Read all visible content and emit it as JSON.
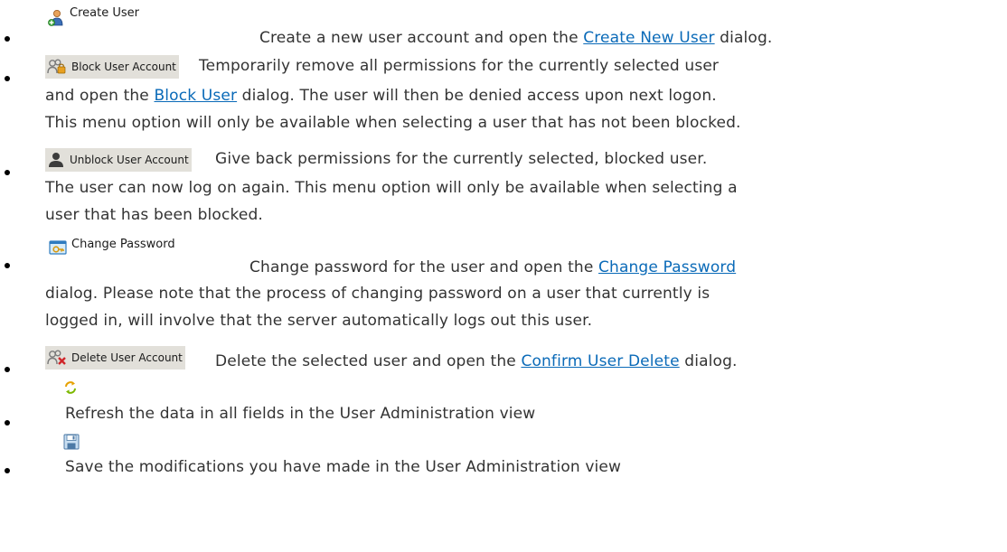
{
  "items": [
    {
      "button_label": "Create User",
      "icon": "create-user-icon",
      "segments": [
        {
          "t": "Create a new user account and open the "
        },
        {
          "link": "Create New User"
        },
        {
          "t": " dialog."
        }
      ]
    },
    {
      "button_label": "Block User Account",
      "icon": "block-user-icon",
      "line1": [
        {
          "t": "Temporarily remove all permissions for the currently selected user"
        }
      ],
      "line2": [
        {
          "t": "and open the "
        },
        {
          "link": "Block User"
        },
        {
          "t": " dialog. The user will then be denied access upon next logon."
        }
      ],
      "line3": "This menu option will only be available when selecting a user that has not been blocked."
    },
    {
      "button_label": "Unblock User Account",
      "icon": "unblock-user-icon",
      "line1": "Give back permissions for the currently selected, blocked user.",
      "line2": "The user can now log on again. This menu option will only be available when selecting a",
      "line3": "user that has been blocked."
    },
    {
      "button_label": "Change Password",
      "icon": "change-password-icon",
      "line1": [
        {
          "t": "Change password for the user and open the "
        },
        {
          "link": "Change Password"
        }
      ],
      "line2": "dialog. Please note that the process of changing password on a user that currently is",
      "line3": "logged in, will involve that the server automatically logs out this user."
    },
    {
      "button_label": "Delete User Account",
      "icon": "delete-user-icon",
      "segments": [
        {
          "t": "Delete the selected user and open the "
        },
        {
          "link": "Confirm User Delete"
        },
        {
          "t": " dialog."
        }
      ]
    },
    {
      "icon": "refresh-icon",
      "text": "Refresh the data in all fields in the User Administration view"
    },
    {
      "icon": "save-icon",
      "text": "Save the modifications you have made in the User Administration view"
    }
  ],
  "b": {
    "i0": {
      "label": "Create User",
      "t1": "Create a new user account and open the ",
      "link": "Create New User",
      "t2": " dialog."
    },
    "i1": {
      "label": "Block User Account",
      "l1": "Temporarily remove all permissions for the currently selected user",
      "l2a": "and open the ",
      "link": "Block User",
      "l2b": " dialog. The user will then be denied access upon next logon.",
      "l3": "This menu option will only be available when selecting a user that has not been blocked."
    },
    "i2": {
      "label": "Unblock User Account",
      "l1": "Give back permissions for the currently selected, blocked user.",
      "l2": "The user can now log on again. This menu option will only be available when selecting a",
      "l3": "user that has been blocked."
    },
    "i3": {
      "label": "Change Password",
      "l1a": "Change password for the user and open the ",
      "link": "Change Password",
      "l2": "dialog. Please note that the process of changing password on a user that currently is",
      "l3": "logged in, will involve that the server automatically logs out this user."
    },
    "i4": {
      "label": "Delete User Account",
      "t1": "Delete the selected user and open the ",
      "link": "Confirm User Delete",
      "t2": " dialog."
    },
    "i5": {
      "text": "Refresh the data in all fields in the User Administration view"
    },
    "i6": {
      "text": "Save the modifications you have made in the User Administration view"
    }
  },
  "colors": {
    "link": "#0a6ab8",
    "text": "#333333",
    "button_bg": "#e2e0da"
  }
}
